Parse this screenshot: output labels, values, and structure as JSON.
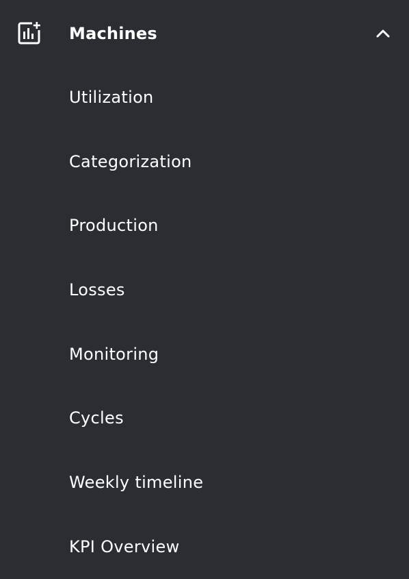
{
  "section": {
    "title": "Machines",
    "icon": "analytics-chart-sparkle-icon",
    "toggle_icon": "chevron-up-icon",
    "expanded": true
  },
  "items": [
    {
      "label": "Utilization"
    },
    {
      "label": "Categorization"
    },
    {
      "label": "Production"
    },
    {
      "label": "Losses"
    },
    {
      "label": "Monitoring"
    },
    {
      "label": "Cycles"
    },
    {
      "label": "Weekly timeline"
    },
    {
      "label": "KPI Overview"
    }
  ],
  "colors": {
    "background": "#2a2d31",
    "text": "#ffffff"
  }
}
